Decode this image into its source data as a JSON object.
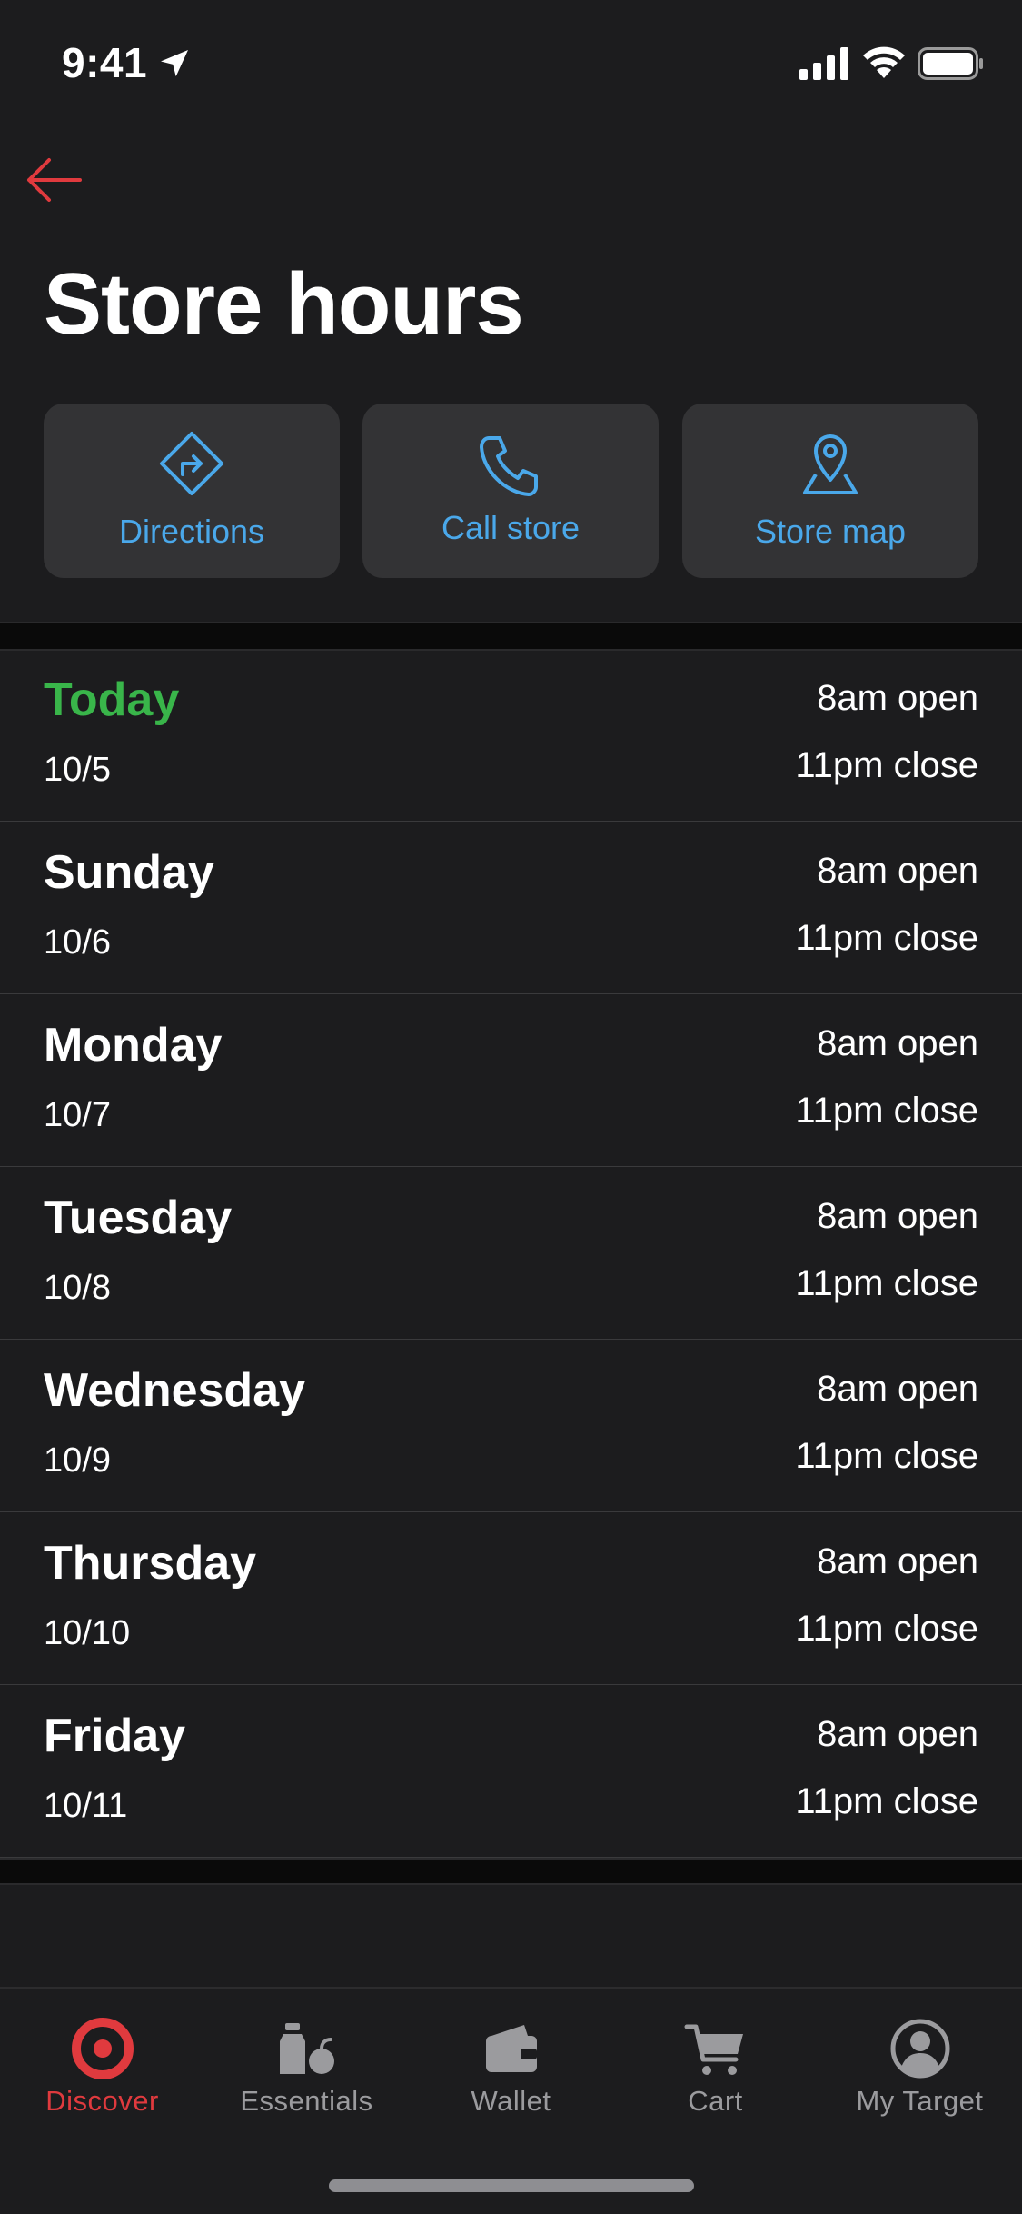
{
  "status_bar": {
    "time": "9:41"
  },
  "header": {
    "title": "Store hours"
  },
  "actions": [
    {
      "label": "Directions",
      "icon": "directions-icon"
    },
    {
      "label": "Call store",
      "icon": "phone-icon"
    },
    {
      "label": "Store map",
      "icon": "map-pin-icon"
    }
  ],
  "hours": [
    {
      "day": "Today",
      "date": "10/5",
      "open": "8am open",
      "close": "11pm close"
    },
    {
      "day": "Sunday",
      "date": "10/6",
      "open": "8am open",
      "close": "11pm close"
    },
    {
      "day": "Monday",
      "date": "10/7",
      "open": "8am open",
      "close": "11pm close"
    },
    {
      "day": "Tuesday",
      "date": "10/8",
      "open": "8am open",
      "close": "11pm close"
    },
    {
      "day": "Wednesday",
      "date": "10/9",
      "open": "8am open",
      "close": "11pm close"
    },
    {
      "day": "Thursday",
      "date": "10/10",
      "open": "8am open",
      "close": "11pm close"
    },
    {
      "day": "Friday",
      "date": "10/11",
      "open": "8am open",
      "close": "11pm close"
    }
  ],
  "tabs": [
    {
      "label": "Discover",
      "icon": "target-bullseye-icon",
      "active": true
    },
    {
      "label": "Essentials",
      "icon": "essentials-icon",
      "active": false
    },
    {
      "label": "Wallet",
      "icon": "wallet-icon",
      "active": false
    },
    {
      "label": "Cart",
      "icon": "cart-icon",
      "active": false
    },
    {
      "label": "My Target",
      "icon": "profile-icon",
      "active": false
    }
  ],
  "colors": {
    "accent_red": "#e03a3e",
    "today_green": "#39b54a",
    "action_blue": "#4aa8ea",
    "background": "#1c1c1e"
  }
}
